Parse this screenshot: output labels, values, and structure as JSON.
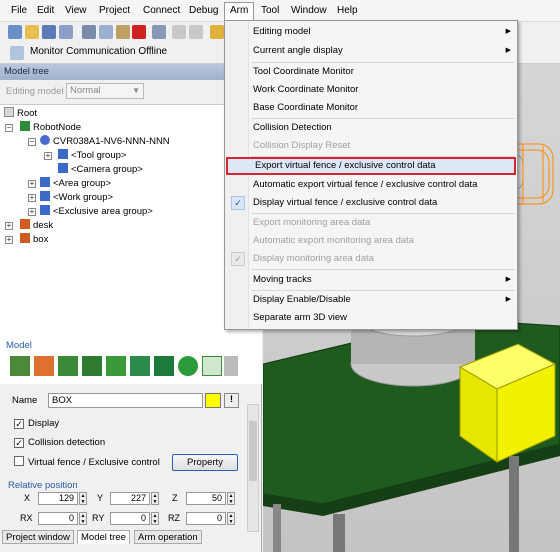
{
  "menubar": {
    "items": [
      "File",
      "Edit",
      "View",
      "Project",
      "Connect",
      "Debug",
      "Arm",
      "Tool",
      "Window",
      "Help"
    ]
  },
  "toolbar": {
    "monitor_label": "Monitor Communication",
    "status": "Offline"
  },
  "model_tree": {
    "header": "Model tree",
    "editing_label": "Editing model",
    "editing_value": "Normal",
    "nodes": [
      "Root",
      "RobotNode",
      "CVR038A1-NV6-NNN-NNN",
      "<Tool group>",
      "<Camera group>",
      "<Area group>",
      "<Work group>",
      "<Exclusive area group>",
      "desk",
      "box"
    ]
  },
  "model": {
    "title": "Model",
    "name_label": "Name",
    "name_value": "BOX",
    "color": "#ffff00",
    "bang": "!",
    "display_label": "Display",
    "collision_label": "Collision detection",
    "fence_label": "Virtual fence / Exclusive control",
    "property_button": "Property",
    "display_checked": true,
    "collision_checked": true,
    "fence_checked": false
  },
  "relative_position": {
    "title": "Relative position",
    "x_label": "X",
    "x": "129",
    "y_label": "Y",
    "y": "227",
    "z_label": "Z",
    "z": "50",
    "rx_label": "RX",
    "rx": "0",
    "ry_label": "RY",
    "ry": "0",
    "rz_label": "RZ",
    "rz": "0"
  },
  "bottom_tabs": [
    "Project window",
    "Model tree",
    "Arm operation"
  ],
  "arm_menu": {
    "editing_model": "Editing model",
    "current_angle": "Current angle display",
    "tool_coord": "Tool Coordinate Monitor",
    "work_coord": "Work Coordinate Monitor",
    "base_coord": "Base Coordinate Monitor",
    "collision_detection": "Collision Detection",
    "collision_reset": "Collision Display Reset",
    "export_fence": "Export virtual fence / exclusive control data",
    "auto_export_fence": "Automatic export virtual fence / exclusive control data",
    "display_fence": "Display virtual fence / exclusive control data",
    "export_monitoring": "Export monitoring area data",
    "auto_export_monitoring": "Automatic export monitoring area data",
    "display_monitoring": "Display monitoring area data",
    "moving_tracks": "Moving tracks",
    "display_enable": "Display Enable/Disable",
    "separate_arm": "Separate arm 3D view",
    "check_glyph": "✓"
  }
}
